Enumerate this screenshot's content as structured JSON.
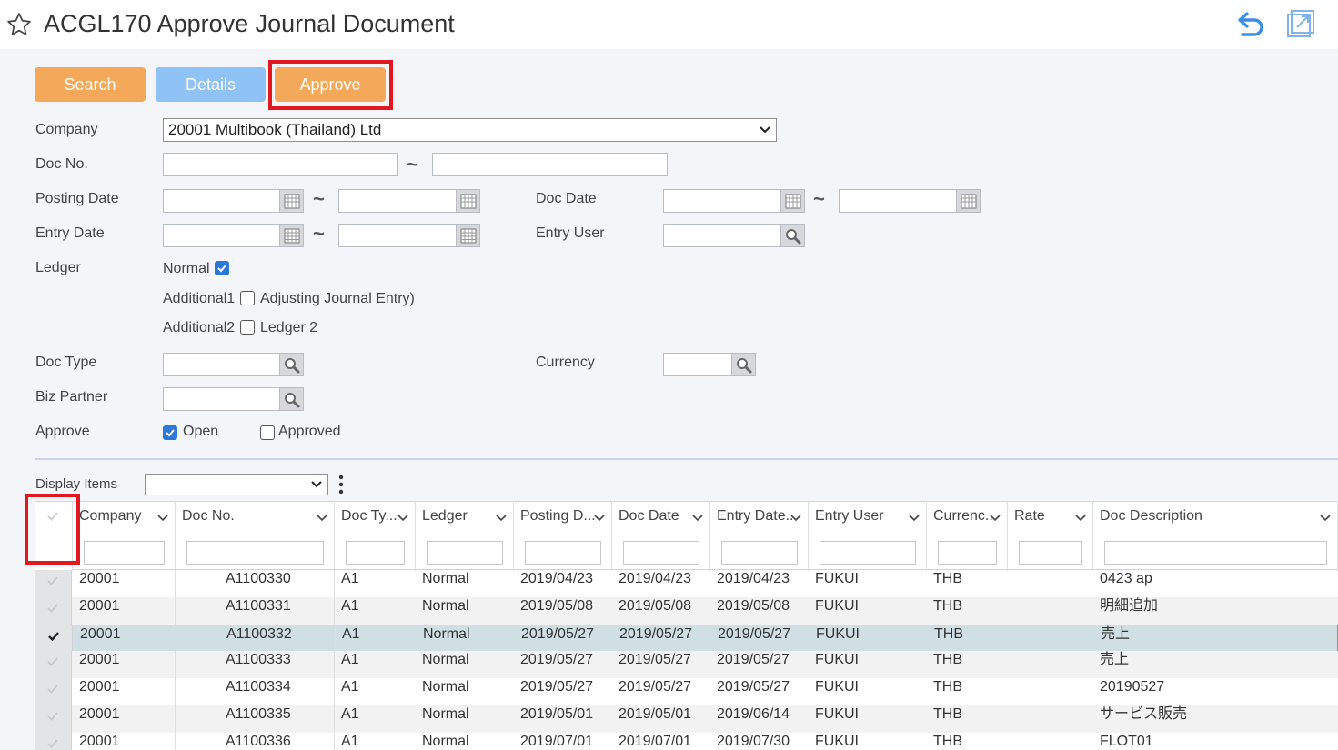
{
  "window": {
    "title": "ACGL170 Approve Journal Document",
    "icons": [
      "star-icon",
      "undo-icon",
      "popout-icon"
    ]
  },
  "toolbar": {
    "search_label": "Search",
    "details_label": "Details",
    "approve_label": "Approve"
  },
  "form": {
    "company_label": "Company",
    "company_value": "20001 Multibook (Thailand) Ltd",
    "doc_no_label": "Doc No.",
    "posting_date_label": "Posting Date",
    "doc_date_label": "Doc Date",
    "entry_date_label": "Entry Date",
    "entry_user_label": "Entry User",
    "ledger_label": "Ledger",
    "ledger_normal": "Normal",
    "ledger_additional1_prefix": "Additional1",
    "ledger_additional1": "Adjusting Journal Entry)",
    "ledger_additional2_prefix": "Additional2",
    "ledger_additional2": "Ledger 2",
    "doc_type_label": "Doc Type",
    "currency_label": "Currency",
    "biz_partner_label": "Biz Partner",
    "approve_label": "Approve",
    "approve_open": "Open",
    "approve_approved": "Approved",
    "range_sep": "~",
    "checked": {
      "ledger_normal": true,
      "ledger_additional1": false,
      "ledger_additional2": false,
      "approve_open": true,
      "approve_approved": false
    }
  },
  "grid": {
    "display_items_label": "Display Items",
    "columns": [
      "Company",
      "Doc No.",
      "Doc Ty...",
      "Ledger",
      "Posting D...",
      "Doc Date",
      "Entry Date...",
      "Entry User",
      "Currenc...",
      "Rate",
      "Doc Description"
    ],
    "rows": [
      {
        "company": "20001",
        "doc_no": "A1100330",
        "doc_type": "A1",
        "ledger": "Normal",
        "posting_date": "2019/04/23",
        "doc_date": "2019/04/23",
        "entry_date": "2019/04/23",
        "entry_user": "FUKUI",
        "currency": "THB",
        "rate": "",
        "description": "0423 ap",
        "selected": false
      },
      {
        "company": "20001",
        "doc_no": "A1100331",
        "doc_type": "A1",
        "ledger": "Normal",
        "posting_date": "2019/05/08",
        "doc_date": "2019/05/08",
        "entry_date": "2019/05/08",
        "entry_user": "FUKUI",
        "currency": "THB",
        "rate": "",
        "description": "明細追加",
        "selected": false
      },
      {
        "company": "20001",
        "doc_no": "A1100332",
        "doc_type": "A1",
        "ledger": "Normal",
        "posting_date": "2019/05/27",
        "doc_date": "2019/05/27",
        "entry_date": "2019/05/27",
        "entry_user": "FUKUI",
        "currency": "THB",
        "rate": "",
        "description": "売上",
        "selected": true
      },
      {
        "company": "20001",
        "doc_no": "A1100333",
        "doc_type": "A1",
        "ledger": "Normal",
        "posting_date": "2019/05/27",
        "doc_date": "2019/05/27",
        "entry_date": "2019/05/27",
        "entry_user": "FUKUI",
        "currency": "THB",
        "rate": "",
        "description": "売上",
        "selected": false
      },
      {
        "company": "20001",
        "doc_no": "A1100334",
        "doc_type": "A1",
        "ledger": "Normal",
        "posting_date": "2019/05/27",
        "doc_date": "2019/05/27",
        "entry_date": "2019/05/27",
        "entry_user": "FUKUI",
        "currency": "THB",
        "rate": "",
        "description": "20190527",
        "selected": false
      },
      {
        "company": "20001",
        "doc_no": "A1100335",
        "doc_type": "A1",
        "ledger": "Normal",
        "posting_date": "2019/05/01",
        "doc_date": "2019/05/01",
        "entry_date": "2019/06/14",
        "entry_user": "FUKUI",
        "currency": "THB",
        "rate": "",
        "description": "サービス販売",
        "selected": false
      },
      {
        "company": "20001",
        "doc_no": "A1100336",
        "doc_type": "A1",
        "ledger": "Normal",
        "posting_date": "2019/07/01",
        "doc_date": "2019/07/01",
        "entry_date": "2019/07/30",
        "entry_user": "FUKUI",
        "currency": "THB",
        "rate": "",
        "description": "FLOT01",
        "selected": false
      }
    ]
  },
  "colors": {
    "orange_button": "#f4a95a",
    "blue_button": "#8fc2f5",
    "highlight_red": "#e0181f",
    "checkbox_blue": "#2b78d6",
    "selected_row": "#cfdfe4"
  }
}
